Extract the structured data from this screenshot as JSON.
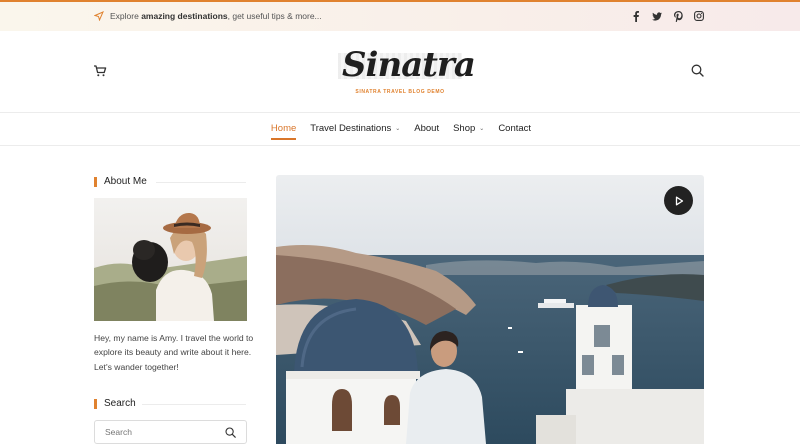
{
  "topbar": {
    "msg_prefix": "Explore ",
    "msg_bold": "amazing destinations",
    "msg_suffix": ", get useful tips & more...",
    "social": [
      "facebook-icon",
      "twitter-icon",
      "pinterest-icon",
      "instagram-icon"
    ]
  },
  "header": {
    "logo": "Sinatra",
    "tagline": "SINATRA TRAVEL BLOG DEMO"
  },
  "nav": {
    "items": [
      {
        "label": "Home",
        "active": true
      },
      {
        "label": "Travel Destinations",
        "dropdown": true
      },
      {
        "label": "About"
      },
      {
        "label": "Shop",
        "dropdown": true
      },
      {
        "label": "Contact"
      }
    ]
  },
  "sidebar": {
    "about_title": "About Me",
    "about_text": "Hey, my name is Amy. I travel the world to explore its beauty and write about it here. Let's wander together!",
    "search_title": "Search",
    "search_placeholder": "Search"
  },
  "colors": {
    "accent": "#e0822f",
    "text": "#222222"
  }
}
